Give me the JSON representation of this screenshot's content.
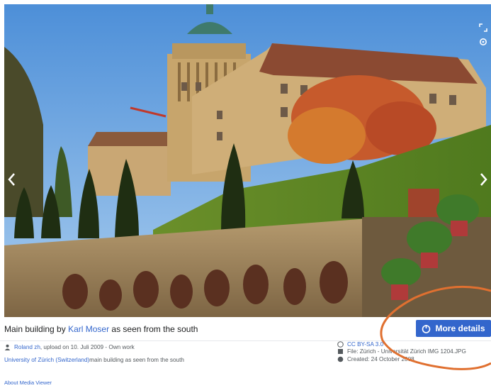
{
  "image": {
    "alt": "Main building of University of Zürich seen from the south"
  },
  "caption": {
    "prefix": "Main building by ",
    "author_link": "Karl Moser",
    "suffix": " as seen from the south"
  },
  "more_details_button": {
    "label": "More details",
    "icon": "info-icon"
  },
  "meta": {
    "uploader": "Roland zh",
    "upload_info": ", upload on 10. Juli 2009 - Own work",
    "description_link": "University of Zürich (Switzerland)",
    "description_rest": " main building as seen from the south",
    "license": "CC BY-SA 3.0",
    "file": "File: Zürich - Universität Zürich IMG 1204.JPG",
    "created": "Created: 24 October 2008"
  },
  "about_link": "About Media Viewer",
  "colors": {
    "accent": "#3366cc",
    "annotation": "#e07030"
  }
}
